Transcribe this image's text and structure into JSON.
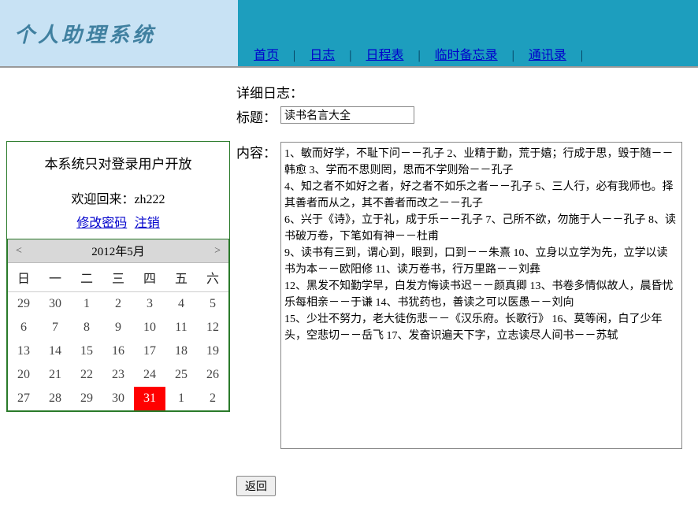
{
  "header": {
    "logo": "个人助理系统",
    "nav": [
      "首页",
      "日志",
      "日程表",
      "临时备忘录",
      "通讯录"
    ]
  },
  "login": {
    "title": "本系统只对登录用户开放",
    "welcome_prefix": "欢迎回来：",
    "username": "zh222",
    "change_pw": "修改密码",
    "logout": "注销"
  },
  "calendar": {
    "title": "2012年5月",
    "day_names": [
      "日",
      "一",
      "二",
      "三",
      "四",
      "五",
      "六"
    ],
    "weeks": [
      [
        "29",
        "30",
        "1",
        "2",
        "3",
        "4",
        "5"
      ],
      [
        "6",
        "7",
        "8",
        "9",
        "10",
        "11",
        "12"
      ],
      [
        "13",
        "14",
        "15",
        "16",
        "17",
        "18",
        "19"
      ],
      [
        "20",
        "21",
        "22",
        "23",
        "24",
        "25",
        "26"
      ],
      [
        "27",
        "28",
        "29",
        "30",
        "31",
        "1",
        "2"
      ]
    ],
    "today": "31",
    "today_row": 4,
    "today_col": 4
  },
  "detail": {
    "heading": "详细日志：",
    "title_label": "标题：",
    "title_value": "读书名言大全",
    "content_label": "内容：",
    "content_value": "1、敏而好学，不耻下问－－孔子 2、业精于勤，荒于嬉；行成于思，毁于随－－韩愈 3、学而不思则罔，思而不学则殆－－孔子\n4、知之者不如好之者，好之者不如乐之者－－孔子 5、三人行，必有我师也。择其善者而从之，其不善者而改之－－孔子\n6、兴于《诗》，立于礼，成于乐－－孔子 7、己所不欲，勿施于人－－孔子 8、读书破万卷，下笔如有神－－杜甫\n9、读书有三到，谓心到，眼到，口到－－朱熹 10、立身以立学为先，立学以读书为本－－欧阳修 11、读万卷书，行万里路－－刘彝\n12、黑发不知勤学早，白发方悔读书迟－－颜真卿 13、书卷多情似故人，晨昏忧乐每相亲－－于谦 14、书犹药也，善读之可以医愚－－刘向\n15、少壮不努力，老大徒伤悲－－《汉乐府。长歌行》 16、莫等闲，白了少年头，空悲切－－岳飞 17、发奋识遍天下字，立志读尽人间书－－苏轼"
  },
  "buttons": {
    "back": "返回"
  }
}
